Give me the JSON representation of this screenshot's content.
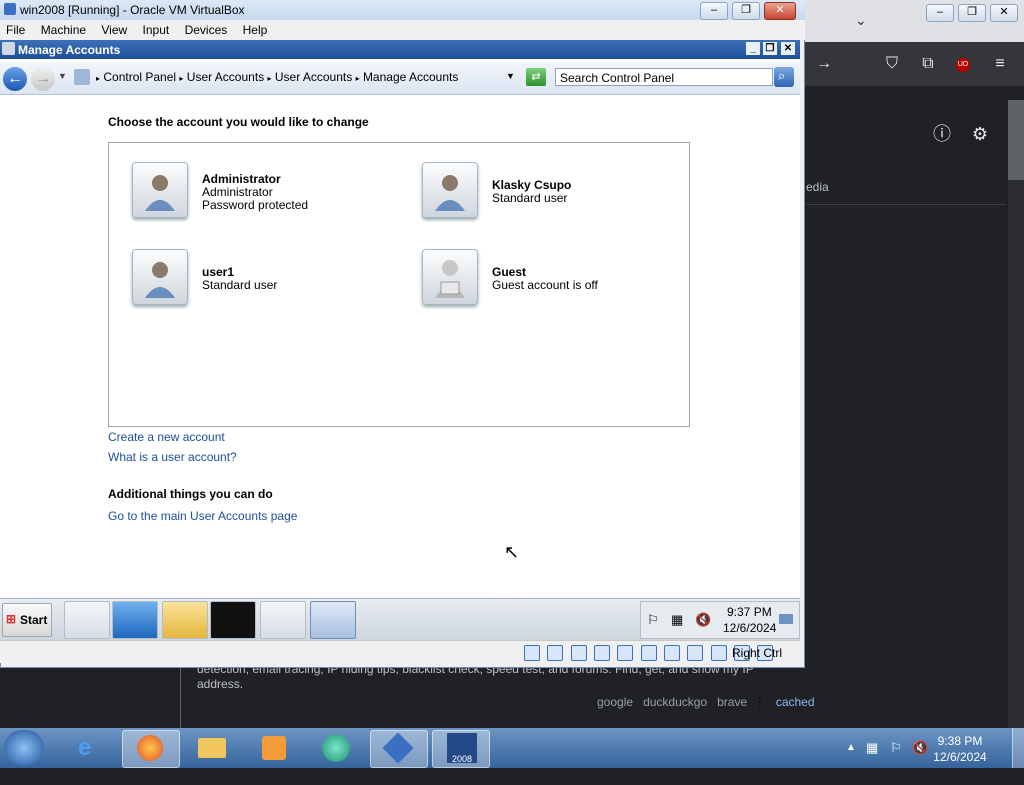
{
  "vbox": {
    "title": "win2008 [Running] - Oracle VM VirtualBox",
    "menu": [
      "File",
      "Machine",
      "View",
      "Input",
      "Devices",
      "Help"
    ],
    "status_text": "Right Ctrl"
  },
  "window": {
    "title": "Manage Accounts",
    "breadcrumb": [
      "Control Panel",
      "User Accounts",
      "User Accounts",
      "Manage Accounts"
    ],
    "search_placeholder": "Search Control Panel"
  },
  "main": {
    "heading": "Choose the account you would like to change",
    "accounts": [
      {
        "name": "Administrator",
        "line1": "Administrator",
        "line2": "Password protected"
      },
      {
        "name": "Klasky Csupo",
        "line1": "Standard user",
        "line2": ""
      },
      {
        "name": "user1",
        "line1": "Standard user",
        "line2": ""
      },
      {
        "name": "Guest",
        "line1": "Guest account is off",
        "line2": ""
      }
    ],
    "link_create": "Create a new account",
    "link_what": "What is a user account?",
    "additional_heading": "Additional things you can do",
    "link_main": "Go to the main User Accounts page"
  },
  "guest_taskbar": {
    "start": "Start",
    "clock_time": "9:37 PM",
    "clock_date": "12/6/2024"
  },
  "host": {
    "text_fragment": "edia",
    "snippet": "detection, email tracing, IP hiding tips, blacklist check, speed test, and forums. Find, get, and show my IP address.",
    "links": [
      "google",
      "duckduckgo",
      "brave",
      "cached"
    ],
    "clock_time": "9:38 PM",
    "clock_date": "12/6/2024"
  },
  "colors": {
    "accent": "#1e4fa0",
    "title_bar": "#1e4f98"
  }
}
